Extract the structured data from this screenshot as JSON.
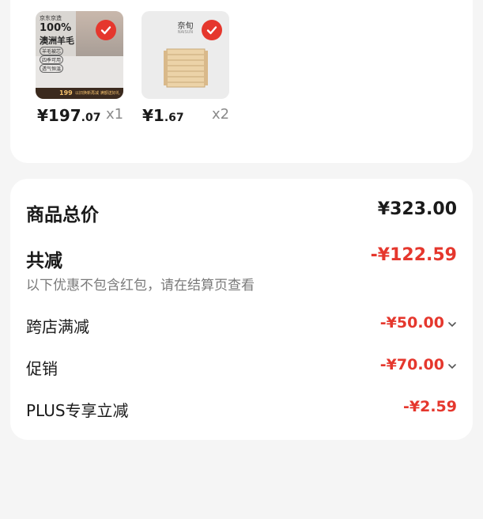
{
  "products": [
    {
      "brand_text": "京东京造",
      "headline": "100%",
      "headline2": "澳洲羊毛",
      "tags": [
        "羊毛被芯",
        "四季可用",
        "透气恒温"
      ],
      "promo_price": "199",
      "promo_text": "以旧换新再减 满额送好礼",
      "price_int": "¥197",
      "price_dec": ".07",
      "qty": "x1",
      "check_icon": "check-circle-icon"
    },
    {
      "brand_text": "奈旬",
      "brand_sub": "NAISUN",
      "price_int": "¥1",
      "price_dec": ".67",
      "qty": "x2",
      "check_icon": "check-circle-icon"
    }
  ],
  "summary": {
    "total_label": "商品总价",
    "total_value": "¥323.00",
    "discount_label": "共减",
    "discount_value": "-¥122.59",
    "discount_note": "以下优惠不包含红包，请在结算页查看",
    "lines": [
      {
        "label": "跨店满减",
        "value": "-¥50.00",
        "chevron": "chevron-down-icon"
      },
      {
        "label": "促销",
        "value": "-¥70.00",
        "chevron": "chevron-down-icon"
      },
      {
        "label": "PLUS专享立减",
        "value": "-¥2.59"
      }
    ]
  },
  "colors": {
    "accent": "#e5372d",
    "background": "#f5f5f5",
    "card": "#ffffff"
  }
}
